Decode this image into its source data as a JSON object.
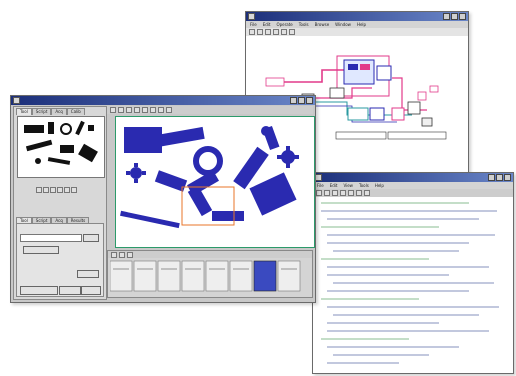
{
  "colors": {
    "blue_part": "#2a2ab0",
    "pink_wire": "#e23a8a",
    "teal": "#2a9aa0",
    "code_blue": "#203a8a",
    "code_green": "#2c8a3a"
  },
  "diagram_window": {
    "title": "",
    "menu": [
      "File",
      "Edit",
      "Operate",
      "Tools",
      "Browse",
      "Window",
      "Help"
    ],
    "node_label_left": "",
    "label_bottom_1": "",
    "label_bottom_2": ""
  },
  "vision_window": {
    "title": "",
    "left_tabs": [
      "Tool",
      "Script",
      "Acq",
      "Calib"
    ],
    "thumbnail_caption": "",
    "lower_tabs": [
      "Tool",
      "Script",
      "Acq",
      "Results"
    ],
    "field_label": "",
    "button_1": "",
    "option_lines": [
      "",
      ""
    ],
    "ok_button": "",
    "cancel_button": "",
    "right_button": ""
  },
  "code_window": {
    "title": "",
    "menu": [
      "File",
      "Edit",
      "View",
      "Tools",
      "Help"
    ],
    "lines": [
      {
        "t": "",
        "k": "c"
      },
      {
        "t": "",
        "k": ""
      },
      {
        "t": "",
        "k": ""
      },
      {
        "t": "",
        "k": "c"
      },
      {
        "t": "",
        "k": ""
      },
      {
        "t": "",
        "k": ""
      },
      {
        "t": "",
        "k": ""
      },
      {
        "t": "",
        "k": "c"
      },
      {
        "t": "",
        "k": ""
      },
      {
        "t": "",
        "k": ""
      },
      {
        "t": "",
        "k": ""
      },
      {
        "t": "",
        "k": ""
      },
      {
        "t": "",
        "k": "c"
      },
      {
        "t": "",
        "k": ""
      },
      {
        "t": "",
        "k": ""
      },
      {
        "t": "",
        "k": ""
      },
      {
        "t": "",
        "k": ""
      },
      {
        "t": "",
        "k": "c"
      },
      {
        "t": "",
        "k": ""
      },
      {
        "t": "",
        "k": ""
      },
      {
        "t": "",
        "k": ""
      },
      {
        "t": "",
        "k": ""
      },
      {
        "t": "",
        "k": ""
      },
      {
        "t": "",
        "k": ""
      }
    ]
  }
}
